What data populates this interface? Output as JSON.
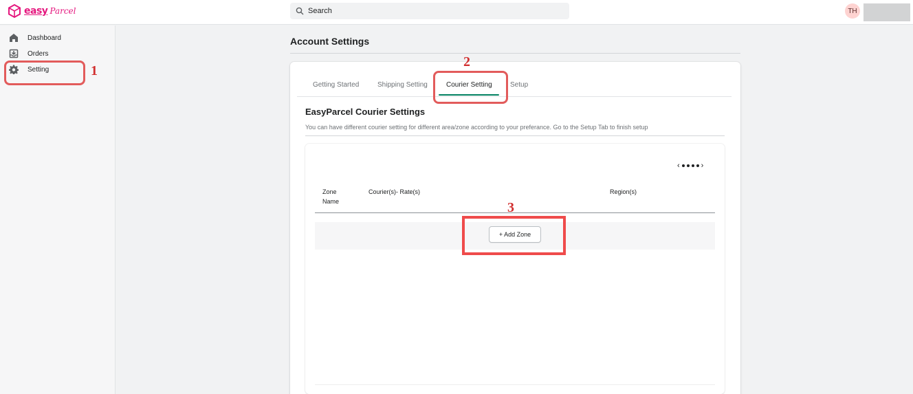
{
  "header": {
    "logo_text": "easy",
    "logo_script": "Parcel",
    "search_placeholder": "Search",
    "avatar_initials": "TH"
  },
  "sidebar": {
    "items": [
      {
        "label": "Dashboard",
        "icon": "home-icon"
      },
      {
        "label": "Orders",
        "icon": "inbox-download-icon"
      },
      {
        "label": "Setting",
        "icon": "gear-icon"
      }
    ]
  },
  "main": {
    "page_title": "Account Settings",
    "tabs": [
      {
        "label": "Getting Started",
        "active": false
      },
      {
        "label": "Shipping Setting",
        "active": false
      },
      {
        "label": "Courier Setting",
        "active": true
      },
      {
        "label": "Setup",
        "active": false
      }
    ],
    "section_title": "EasyParcel Courier Settings",
    "section_description": "You can have different courier setting for different area/zone according to your preferance. Go to the Setup Tab to finish setup",
    "table": {
      "columns": [
        "Zone Name",
        "Courier(s)- Rate(s)",
        "Region(s)"
      ]
    },
    "add_zone_label": "+ Add Zone"
  },
  "annotations": {
    "marker_1": "1",
    "marker_2": "2",
    "marker_3": "3"
  },
  "colors": {
    "brand": "#e5177e",
    "accent_tab": "#008060",
    "annotation": "#e25b5b"
  }
}
